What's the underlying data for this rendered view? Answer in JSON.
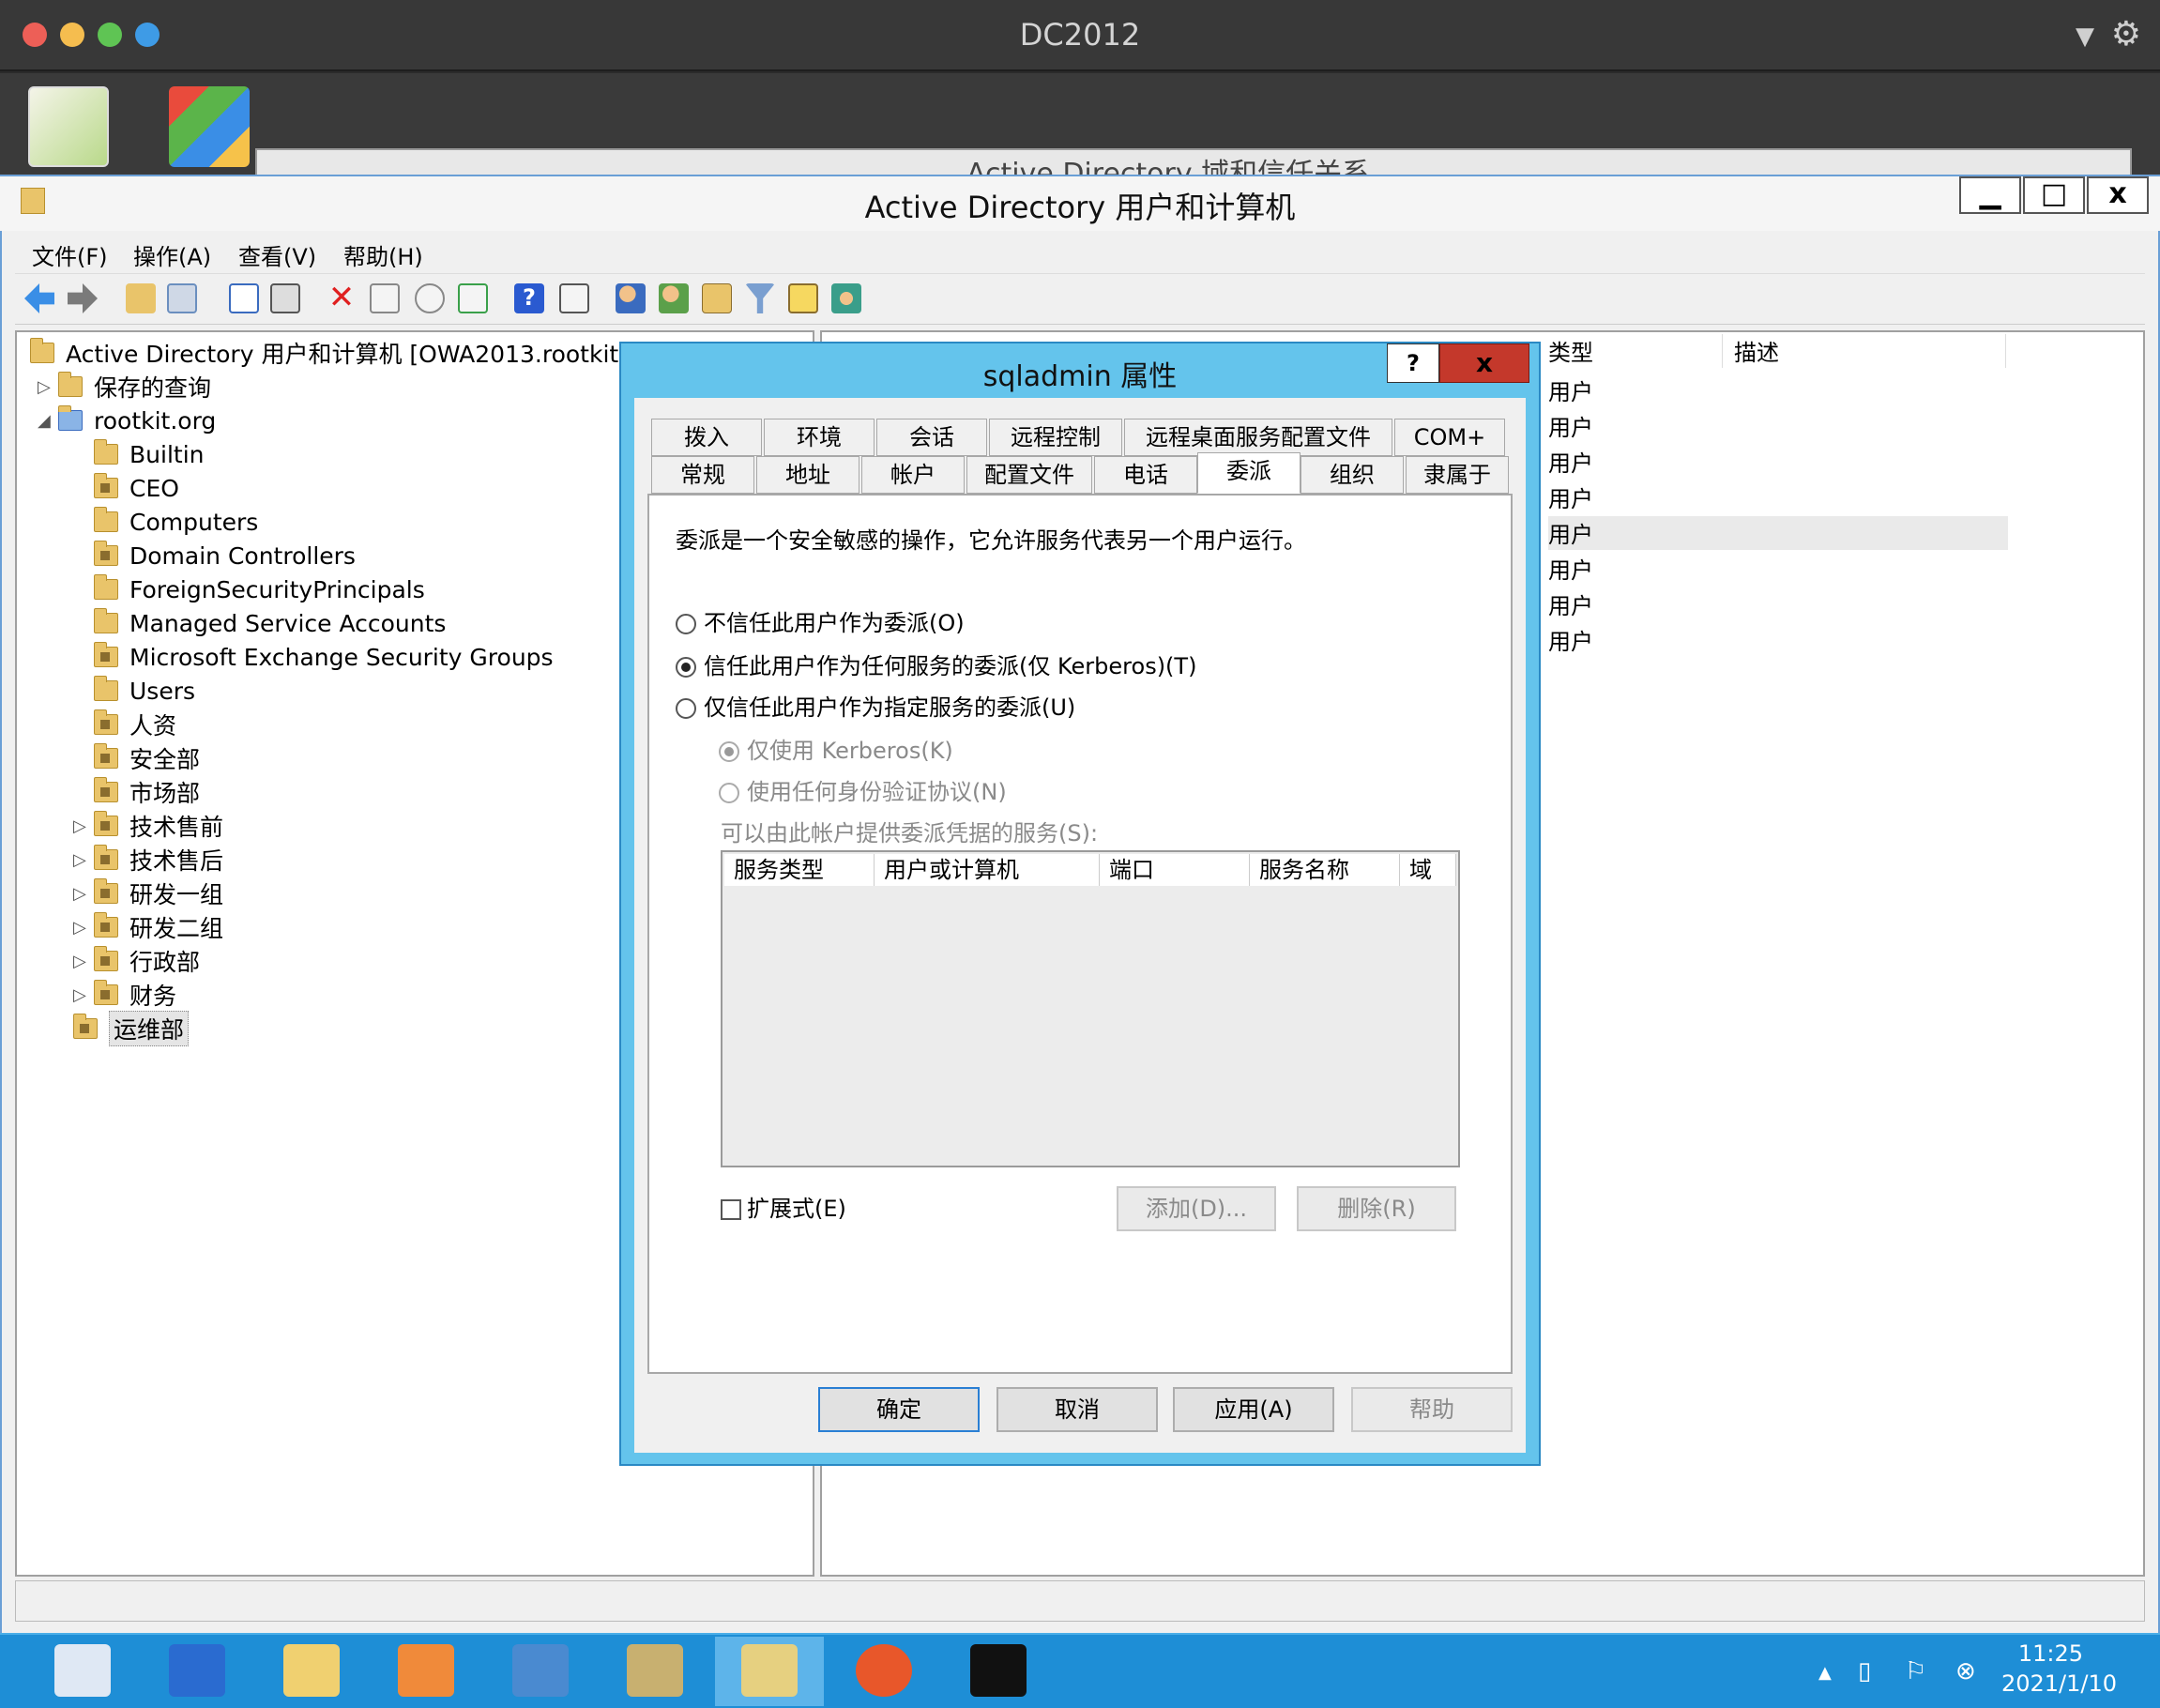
{
  "mac": {
    "title": "DC2012"
  },
  "background_window": {
    "title": "Active Directory 域和信任关系"
  },
  "app": {
    "title": "Active Directory 用户和计算机",
    "menu": [
      "文件(F)",
      "操作(A)",
      "查看(V)",
      "帮助(H)"
    ]
  },
  "toolbar_icons": [
    "back-icon",
    "forward-icon",
    "up-folder-icon",
    "show-tree-icon",
    "cut-icon",
    "paste-icon",
    "delete-icon",
    "properties-icon",
    "refresh-icon",
    "export-icon",
    "help-icon",
    "console-icon",
    "new-user-icon",
    "new-group-icon",
    "new-ou-icon",
    "filter-icon",
    "find-icon",
    "add-to-group-icon"
  ],
  "tree": {
    "root": "Active Directory 用户和计算机 [OWA2013.rootkit.org]",
    "saved_queries": "保存的查询",
    "domain": "rootkit.org",
    "children": [
      {
        "label": "Builtin",
        "ou": false,
        "expandable": false
      },
      {
        "label": "CEO",
        "ou": true,
        "expandable": false
      },
      {
        "label": "Computers",
        "ou": false,
        "expandable": false
      },
      {
        "label": "Domain Controllers",
        "ou": true,
        "expandable": false
      },
      {
        "label": "ForeignSecurityPrincipals",
        "ou": false,
        "expandable": false
      },
      {
        "label": "Managed Service Accounts",
        "ou": false,
        "expandable": false
      },
      {
        "label": "Microsoft Exchange Security Groups",
        "ou": true,
        "expandable": false
      },
      {
        "label": "Users",
        "ou": false,
        "expandable": false
      },
      {
        "label": "人资",
        "ou": true,
        "expandable": false
      },
      {
        "label": "安全部",
        "ou": true,
        "expandable": false
      },
      {
        "label": "市场部",
        "ou": true,
        "expandable": false
      },
      {
        "label": "技术售前",
        "ou": true,
        "expandable": true
      },
      {
        "label": "技术售后",
        "ou": true,
        "expandable": true
      },
      {
        "label": "研发一组",
        "ou": true,
        "expandable": true
      },
      {
        "label": "研发二组",
        "ou": true,
        "expandable": true
      },
      {
        "label": "行政部",
        "ou": true,
        "expandable": true
      },
      {
        "label": "财务",
        "ou": true,
        "expandable": true
      }
    ],
    "selected": "运维部"
  },
  "list": {
    "columns": [
      "类型",
      "描述"
    ],
    "rows": [
      "用户",
      "用户",
      "用户",
      "用户",
      "用户",
      "用户",
      "用户",
      "用户"
    ],
    "selected_row": 4
  },
  "dialog": {
    "title": "sqladmin 属性",
    "help_btn": "?",
    "close_btn": "x",
    "tabs_row1": [
      "拨入",
      "环境",
      "会话",
      "远程控制",
      "远程桌面服务配置文件",
      "COM+"
    ],
    "tabs_row2": [
      "常规",
      "地址",
      "帐户",
      "配置文件",
      "电话",
      "委派",
      "组织",
      "隶属于"
    ],
    "active_tab": "委派",
    "description": "委派是一个安全敏感的操作，它允许服务代表另一个用户运行。",
    "options": [
      {
        "label": "不信任此用户作为委派(O)",
        "checked": false,
        "enabled": true
      },
      {
        "label": "信任此用户作为任何服务的委派(仅 Kerberos)(T)",
        "checked": true,
        "enabled": true
      },
      {
        "label": "仅信任此用户作为指定服务的委派(U)",
        "checked": false,
        "enabled": true
      }
    ],
    "sub_options": [
      {
        "label": "仅使用 Kerberos(K)",
        "checked": true,
        "enabled": false
      },
      {
        "label": "使用任何身份验证协议(N)",
        "checked": false,
        "enabled": false
      }
    ],
    "services_label": "可以由此帐户提供委派凭据的服务(S):",
    "service_columns": [
      "服务类型",
      "用户或计算机",
      "端口",
      "服务名称",
      "域"
    ],
    "expanded_label": "扩展式(E)",
    "add_btn": "添加(D)...",
    "remove_btn": "删除(R)",
    "ok_btn": "确定",
    "cancel_btn": "取消",
    "apply_btn": "应用(A)",
    "help_footer_btn": "帮助"
  },
  "taskbar": {
    "apps": [
      "server-manager-icon",
      "powershell-icon",
      "file-explorer-icon",
      "exchange-shell-icon",
      "ad-sites-icon",
      "ad-domains-icon",
      "ad-users-icon",
      "firefox-icon",
      "cmd-icon"
    ],
    "time": "11:25",
    "date": "2021/1/10"
  },
  "colors": {
    "dialog_frame": "#64c4ec",
    "taskbar": "#1e8ed6",
    "close_red": "#c4382b"
  }
}
